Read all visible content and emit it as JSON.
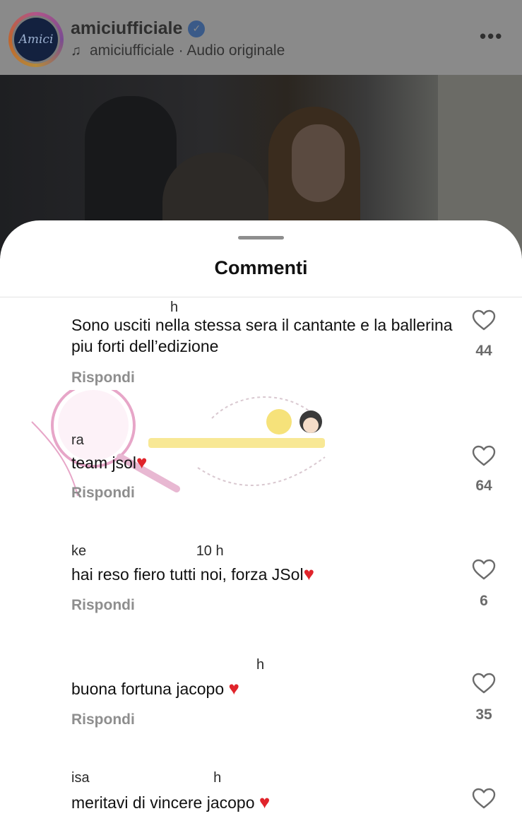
{
  "header": {
    "username": "amiciufficiale",
    "avatar_text": "Amici",
    "audio_label": "amiciufficiale · Audio originale"
  },
  "sheet": {
    "title": "Commenti"
  },
  "comments": [
    {
      "meta": "",
      "meta_time": "h",
      "text": "Sono usciti nella stessa sera il cantante e la ballerina piu forti dell’edizione",
      "reply": "Rispondi",
      "likes": "44"
    },
    {
      "meta": "ra",
      "meta_time": "",
      "text": "team jsol",
      "reply": "Rispondi",
      "likes": "64"
    },
    {
      "meta": "ke",
      "meta_time": "10 h",
      "text": "hai reso fiero tutti noi, forza JSol",
      "reply": "Rispondi",
      "likes": "6"
    },
    {
      "meta": "",
      "meta_time": "h",
      "text": "buona fortuna jacopo",
      "reply": "Rispondi",
      "likes": "35"
    },
    {
      "meta": "isa",
      "meta_time": "h",
      "text": "meritavi di vincere jacopo",
      "reply": "",
      "likes": ""
    }
  ],
  "icons": {
    "like": "heart-outline-icon",
    "emoji": "red-heart-emoji"
  },
  "colors": {
    "accent_heart": "#e0242b",
    "secondary_text": "#8e8e8e"
  }
}
